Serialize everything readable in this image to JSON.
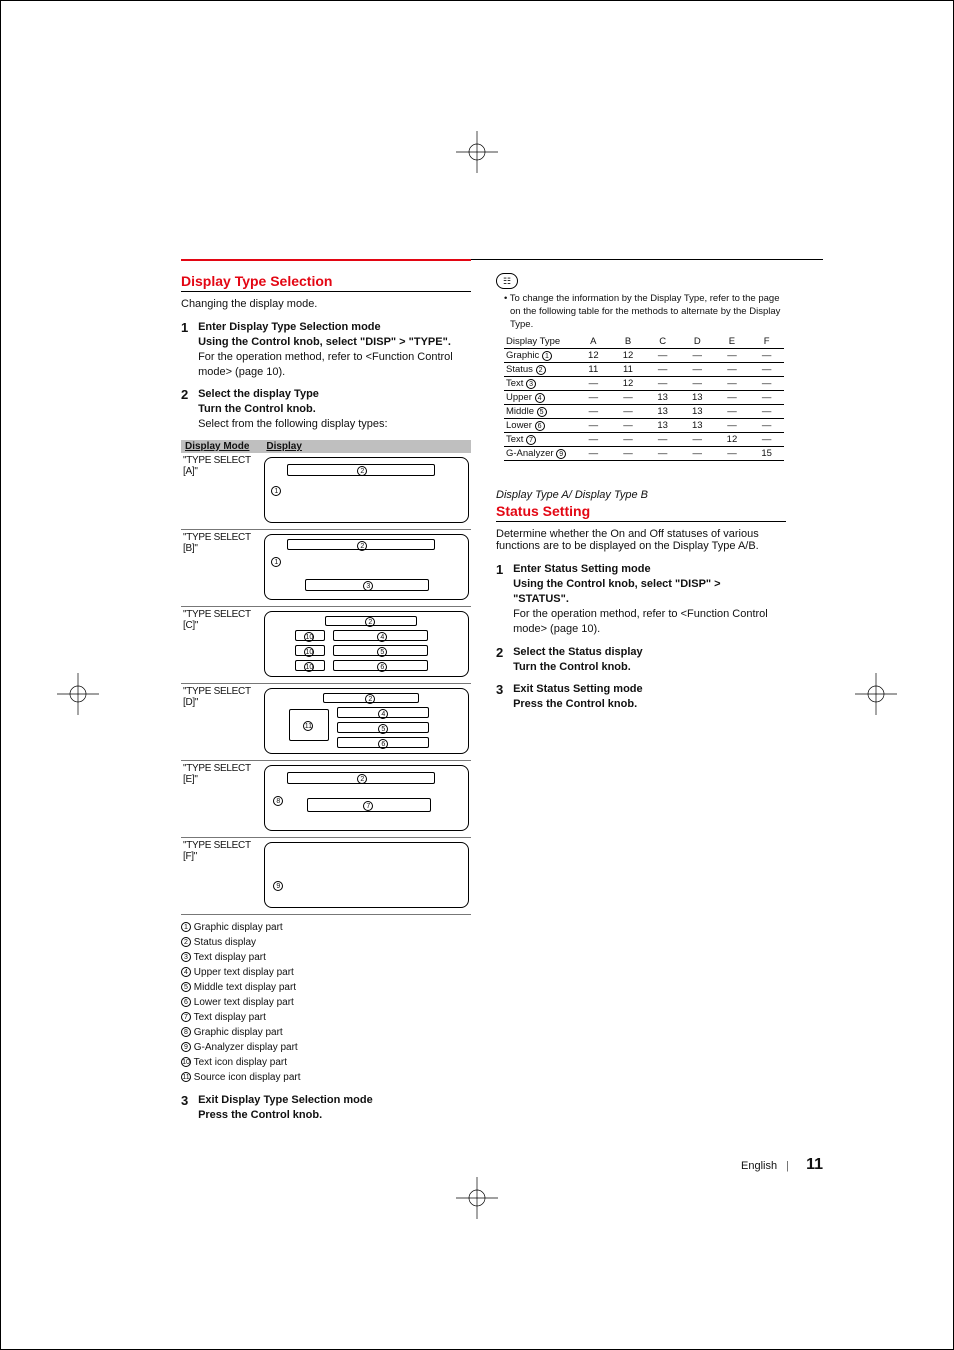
{
  "left": {
    "h1": "Display Type Selection",
    "subtitle": "Changing the display mode.",
    "step1": {
      "title": "Enter Display Type Selection mode",
      "action": "Using the Control knob, select \"DISP\" > \"TYPE\".",
      "note": "For the operation method, refer to <Function Control mode> (page 10)."
    },
    "step2": {
      "title": "Select the display Type",
      "action": "Turn the Control knob.",
      "note": "Select from the following display types:"
    },
    "tableHeader": {
      "c1": "Display Mode",
      "c2": "Display"
    },
    "modes": [
      "\"TYPE SELECT [A]\"",
      "\"TYPE SELECT [B]\"",
      "\"TYPE SELECT [C]\"",
      "\"TYPE SELECT [D]\"",
      "\"TYPE SELECT [E]\"",
      "\"TYPE SELECT [F]\""
    ],
    "legend": [
      "Graphic display part",
      "Status display",
      "Text display part",
      "Upper text display part",
      "Middle text display part",
      "Lower text display part",
      "Text display part",
      "Graphic display part",
      "G-Analyzer display part",
      "Text icon display part",
      "Source icon display part"
    ],
    "step3": {
      "title": "Exit Display Type Selection mode",
      "action": "Press the Control knob."
    }
  },
  "right": {
    "noteIcon": "☷",
    "bullet": "• ",
    "noteText": "To change the information by the Display Type, refer to the page on the following table for the methods to alternate by the Display Type.",
    "table": {
      "head": [
        "Display Type",
        "A",
        "B",
        "C",
        "D",
        "E",
        "F"
      ],
      "rows": [
        {
          "label": "Graphic",
          "circ": "1",
          "cells": [
            "12",
            "12",
            "—",
            "—",
            "—",
            "—"
          ]
        },
        {
          "label": "Status",
          "circ": "2",
          "cells": [
            "11",
            "11",
            "—",
            "—",
            "—",
            "—"
          ]
        },
        {
          "label": "Text",
          "circ": "3",
          "cells": [
            "—",
            "12",
            "—",
            "—",
            "—",
            "—"
          ]
        },
        {
          "label": "Upper",
          "circ": "4",
          "cells": [
            "—",
            "—",
            "13",
            "13",
            "—",
            "—"
          ]
        },
        {
          "label": "Middle",
          "circ": "5",
          "cells": [
            "—",
            "—",
            "13",
            "13",
            "—",
            "—"
          ]
        },
        {
          "label": "Lower",
          "circ": "6",
          "cells": [
            "—",
            "—",
            "13",
            "13",
            "—",
            "—"
          ]
        },
        {
          "label": "Text",
          "circ": "7",
          "cells": [
            "—",
            "—",
            "—",
            "—",
            "12",
            "—"
          ]
        },
        {
          "label": "G-Analyzer",
          "circ": "9",
          "cells": [
            "—",
            "—",
            "—",
            "—",
            "—",
            "15"
          ]
        }
      ]
    },
    "sectionLabel": "Display Type A/ Display Type B",
    "h1": "Status Setting",
    "subtitle": "Determine whether the On and Off statuses of various functions are to be displayed on the Display Type A/B.",
    "step1": {
      "title": "Enter Status Setting mode",
      "action": "Using the Control knob, select \"DISP\" > \"STATUS\".",
      "note": "For the operation method, refer to <Function Control mode> (page 10)."
    },
    "step2": {
      "title": "Select the Status display",
      "action": "Turn the Control knob."
    },
    "step3": {
      "title": "Exit Status Setting mode",
      "action": "Press the Control knob."
    }
  },
  "footer": {
    "lang": "English",
    "page": "11"
  },
  "chart_data": {
    "type": "table",
    "title": "Methods to alternate by Display Type (page references)",
    "columns": [
      "Display Type",
      "A",
      "B",
      "C",
      "D",
      "E",
      "F"
    ],
    "rows": [
      [
        "Graphic (1)",
        12,
        12,
        null,
        null,
        null,
        null
      ],
      [
        "Status (2)",
        11,
        11,
        null,
        null,
        null,
        null
      ],
      [
        "Text (3)",
        null,
        12,
        null,
        null,
        null,
        null
      ],
      [
        "Upper (4)",
        null,
        null,
        13,
        13,
        null,
        null
      ],
      [
        "Middle (5)",
        null,
        null,
        13,
        13,
        null,
        null
      ],
      [
        "Lower (6)",
        null,
        null,
        13,
        13,
        null,
        null
      ],
      [
        "Text (7)",
        null,
        null,
        null,
        null,
        12,
        null
      ],
      [
        "G-Analyzer (9)",
        null,
        null,
        null,
        null,
        null,
        15
      ]
    ]
  }
}
